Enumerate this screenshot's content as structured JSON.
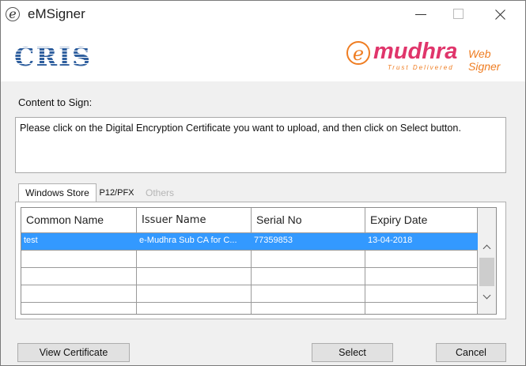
{
  "window": {
    "title": "eMSigner"
  },
  "banner": {
    "left_logo_text": "CRIS",
    "right_logo_mark": "e",
    "right_logo_word": "mudhra",
    "right_logo_tagline": "Trust Delivered",
    "right_logo_suffix": "Web Signer",
    "colors": {
      "cris_blue": "#2f5f9e",
      "emudhra_pink": "#e0356b",
      "emudhra_orange": "#ef7d22"
    }
  },
  "content": {
    "label": "Content to Sign:",
    "text": "Please click on the Digital Encryption Certificate you want to upload, and then click on Select button."
  },
  "tabs": [
    {
      "label": "Windows Store",
      "active": true,
      "enabled": true
    },
    {
      "label": "P12/PFX",
      "active": false,
      "enabled": true
    },
    {
      "label": "Others",
      "active": false,
      "enabled": false
    }
  ],
  "table": {
    "columns": [
      "Common Name",
      "Issuer Name",
      "Serial No",
      "Expiry Date"
    ],
    "rows": [
      [
        "test",
        "e-Mudhra Sub CA for C...",
        "77359853",
        "13-04-2018"
      ],
      [
        "",
        "",
        "",
        ""
      ],
      [
        "",
        "",
        "",
        ""
      ],
      [
        "",
        "",
        "",
        ""
      ],
      [
        "",
        "",
        "",
        ""
      ]
    ],
    "selected_row": 0,
    "selection_color": "#3399ff"
  },
  "buttons": {
    "view_certificate": "View Certificate",
    "select": "Select",
    "cancel": "Cancel"
  }
}
